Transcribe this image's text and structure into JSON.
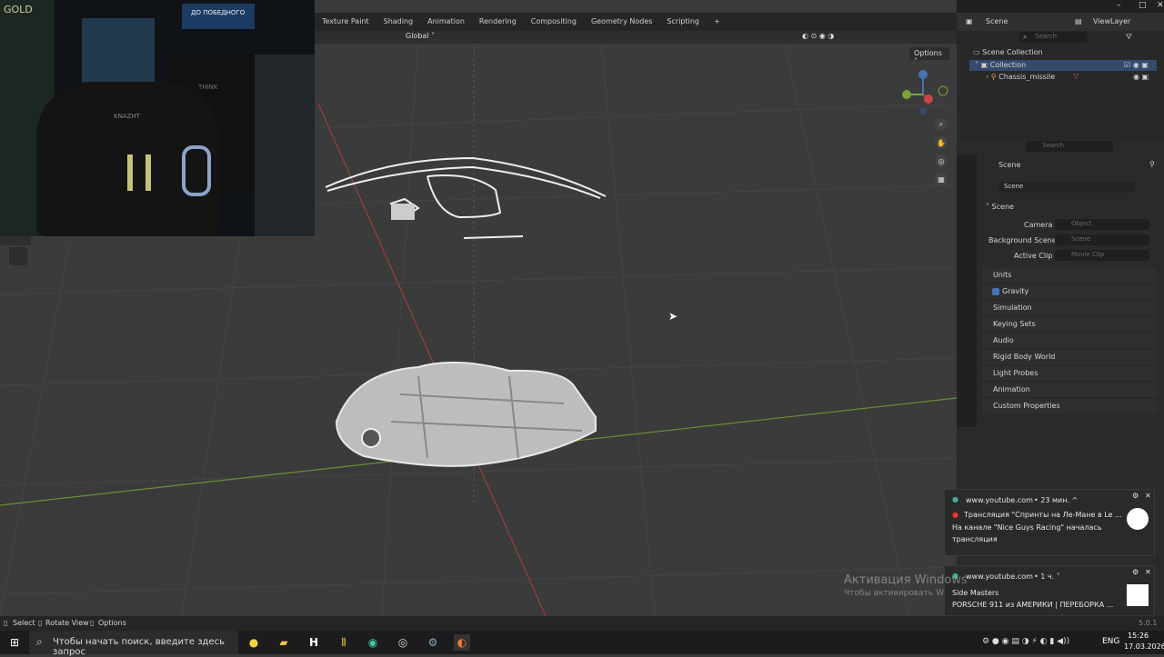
{
  "workspace_tabs": [
    "Texture Paint",
    "Shading",
    "Animation",
    "Rendering",
    "Compositing",
    "Geometry Nodes",
    "Scripting",
    "+"
  ],
  "window_controls": {
    "minimize": "–",
    "maximize": "□",
    "close": "✕"
  },
  "viewport_header": {
    "transform": "Global",
    "options": "Options"
  },
  "webcam": {
    "shop_sign": "GOLD",
    "banner": "ДО ПОБЕДНОГО",
    "chair_brand": "KNAZHT",
    "poster": "THINK"
  },
  "outliner": {
    "scene_label": "Scene",
    "view_layer": "ViewLayer",
    "search_placeholder": "Search",
    "items": [
      {
        "label": "Scene Collection"
      },
      {
        "label": "Collection"
      },
      {
        "label": "Chassis_missile"
      }
    ]
  },
  "properties": {
    "search_placeholder": "Search",
    "header": "Scene",
    "scene_field": "Scene",
    "section": "Scene",
    "camera_label": "Camera",
    "camera_value": "Object",
    "background_label": "Background Scene",
    "background_value": "Scene",
    "clip_label": "Active Clip",
    "clip_value": "Movie Clip",
    "panels": [
      "Units",
      "Gravity",
      "Simulation",
      "Keying Sets",
      "Audio",
      "Rigid Body World",
      "Light Probes",
      "Animation",
      "Custom Properties"
    ]
  },
  "statusbar": {
    "select": "Select",
    "rotate": "Rotate View",
    "options": "Options",
    "version": "5.0.1"
  },
  "notifications": [
    {
      "source": "www.youtube.com",
      "time": "• 23 мин. ^",
      "title": "Трансляция \"Спринты на Ле-Мане в Le ...",
      "body1": "На канале \"Nice Guys Racing\" началась",
      "body2": "трансляция"
    },
    {
      "source": "www.youtube.com",
      "time": "• 1 ч. ˅",
      "title": "Side Masters",
      "body1": "PORSCHE 911 из АМЕРИКИ | ПЕРЕБОРКА ..."
    }
  ],
  "watermark": {
    "line1": "Активация Windows",
    "line2": "Чтобы активировать Windows, перейдите в раздел \"Параметры\"."
  },
  "taskbar": {
    "search_placeholder": "Чтобы начать поиск, введите здесь запрос",
    "lang": "ENG",
    "time": "15:26",
    "date": "17.03.2026"
  },
  "colors": {
    "accent": "#4772b3",
    "x_axis": "#b34a4a",
    "y_axis": "#7aa33a",
    "bg": "#3b3b3b"
  }
}
